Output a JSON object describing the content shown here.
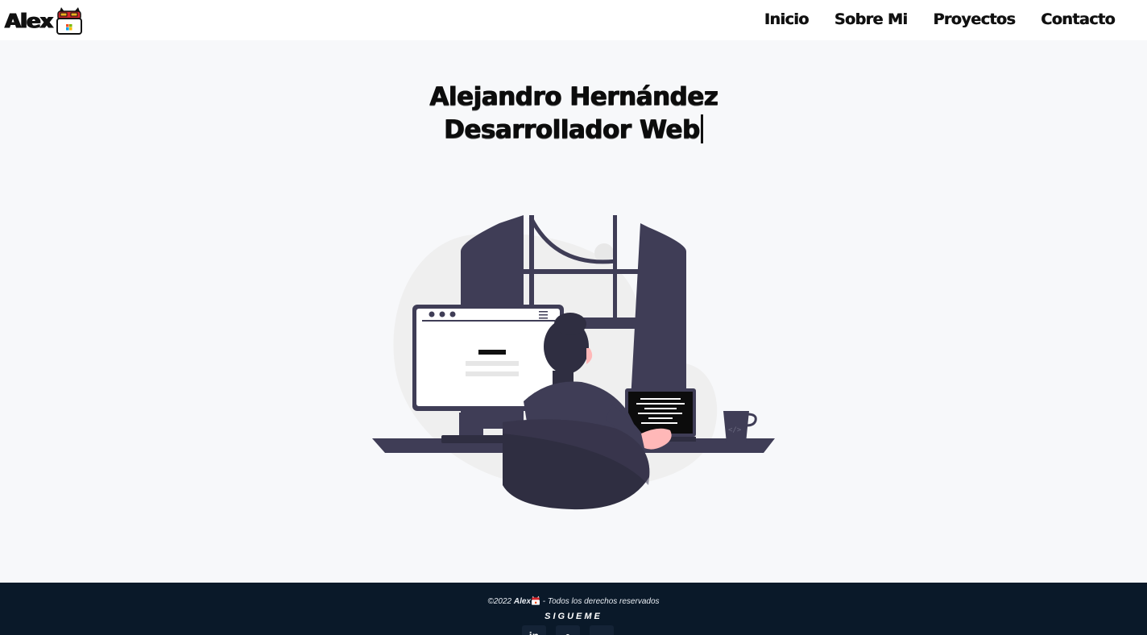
{
  "header": {
    "logo_text": "Alex",
    "nav": [
      {
        "label": "Inicio"
      },
      {
        "label": "Sobre Mi"
      },
      {
        "label": "Proyectos"
      },
      {
        "label": "Contacto"
      }
    ]
  },
  "hero": {
    "name": "Alejandro Hernández",
    "role": "Desarrollador Web"
  },
  "illustration": {
    "browser_icon": "browser-window-icon",
    "laptop_code_icon": "laptop-terminal-icon",
    "mug_label": "</>"
  },
  "footer": {
    "copyright_prefix": "©2022",
    "brand": "Alex",
    "copyright_suffix": "- Todos los derechos reservados",
    "follow_label": "SIGUEME",
    "socials": [
      {
        "name": "linkedin-icon",
        "glyph": "in"
      },
      {
        "name": "github-icon",
        "glyph": "●"
      },
      {
        "name": "email-icon",
        "glyph": "▬"
      }
    ]
  },
  "colors": {
    "dark_navy": "#0a1929",
    "illustration_dark": "#3f3d56",
    "skin": "#ffb8b8"
  }
}
